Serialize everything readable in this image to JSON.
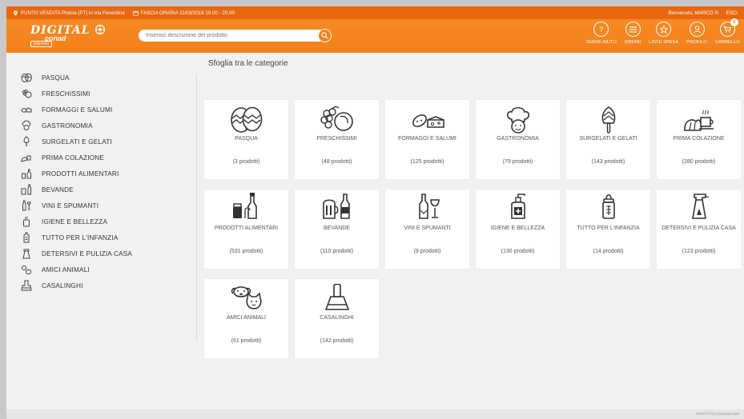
{
  "topbar": {
    "store": "PUNTO VENDITA Pistoia (PT) in Via Fiorentina",
    "time_slot": "FASCIA ORARIA 11/03/2016 19.00 - 20.00",
    "welcome": "Benvenuto, MARCO R.",
    "logout": "ESCI"
  },
  "header": {
    "logo_line1": "DIGITAL",
    "logo_line2": "conad",
    "logo_line3": "popolare",
    "search_placeholder": "Inserisci descrizione del prodotto",
    "nav": [
      {
        "label": "SERVE AIUTO",
        "icon": "question-icon"
      },
      {
        "label": "ORDINI",
        "icon": "list-icon"
      },
      {
        "label": "LISTE SPESA",
        "icon": "star-icon"
      },
      {
        "label": "PROFILO",
        "icon": "user-icon"
      },
      {
        "label": "CARRELLO",
        "icon": "cart-icon",
        "badge": "0"
      }
    ],
    "accent": "#f3801a"
  },
  "sidebar": {
    "items": [
      {
        "label": "PASQUA",
        "icon": "easter-egg-icon"
      },
      {
        "label": "FRESCHISSIMI",
        "icon": "fresh-food-icon"
      },
      {
        "label": "FORMAGGI E SALUMI",
        "icon": "cheese-salami-icon"
      },
      {
        "label": "GASTRONOMIA",
        "icon": "chef-icon"
      },
      {
        "label": "SURGELATI E GELATI",
        "icon": "ice-cream-icon"
      },
      {
        "label": "PRIMA COLAZIONE",
        "icon": "breakfast-icon"
      },
      {
        "label": "PRODOTTI ALIMENTARI",
        "icon": "grocery-icon"
      },
      {
        "label": "BEVANDE",
        "icon": "beverage-icon"
      },
      {
        "label": "VINI E SPUMANTI",
        "icon": "wine-icon"
      },
      {
        "label": "IGIENE E BELLEZZA",
        "icon": "soap-dispenser-icon"
      },
      {
        "label": "TUTTO PER L'INFANZIA",
        "icon": "baby-bottle-icon"
      },
      {
        "label": "DETERSIVI E PULIZIA CASA",
        "icon": "spray-bottle-icon"
      },
      {
        "label": "AMICI ANIMALI",
        "icon": "pets-icon"
      },
      {
        "label": "CASALINGHI",
        "icon": "dustpan-icon"
      }
    ]
  },
  "main": {
    "title": "Sfoglia tra le categorie",
    "cards": [
      {
        "name": "PASQUA",
        "count": "(3 prodotti)"
      },
      {
        "name": "FRESCHISSIMI",
        "count": "(48 prodotti)"
      },
      {
        "name": "FORMAGGI E SALUMI",
        "count": "(125 prodotti)"
      },
      {
        "name": "GASTRONOMIA",
        "count": "(79 prodotti)"
      },
      {
        "name": "SURGELATI E GELATI",
        "count": "(143 prodotti)"
      },
      {
        "name": "PRIMA COLAZIONE",
        "count": "(280 prodotti)"
      },
      {
        "name": "PRODOTTI ALIMENTARI",
        "count": "(531 prodotti)"
      },
      {
        "name": "BEVANDE",
        "count": "(110 prodotti)"
      },
      {
        "name": "VINI E SPUMANTI",
        "count": "(9 prodotti)"
      },
      {
        "name": "IGIENE E BELLEZZA",
        "count": "(130 prodotti)"
      },
      {
        "name": "TUTTO PER L'INFANZIA",
        "count": "(14 prodotti)"
      },
      {
        "name": "DETERSIVI E PULIZIA CASA",
        "count": "(123 prodotti)"
      },
      {
        "name": "AMICI ANIMALI",
        "count": "(61 prodotti)"
      },
      {
        "name": "CASALINGHI",
        "count": "(142 prodotti)"
      }
    ]
  },
  "footer": {
    "text": "PARTITA IVA 01839110469"
  }
}
